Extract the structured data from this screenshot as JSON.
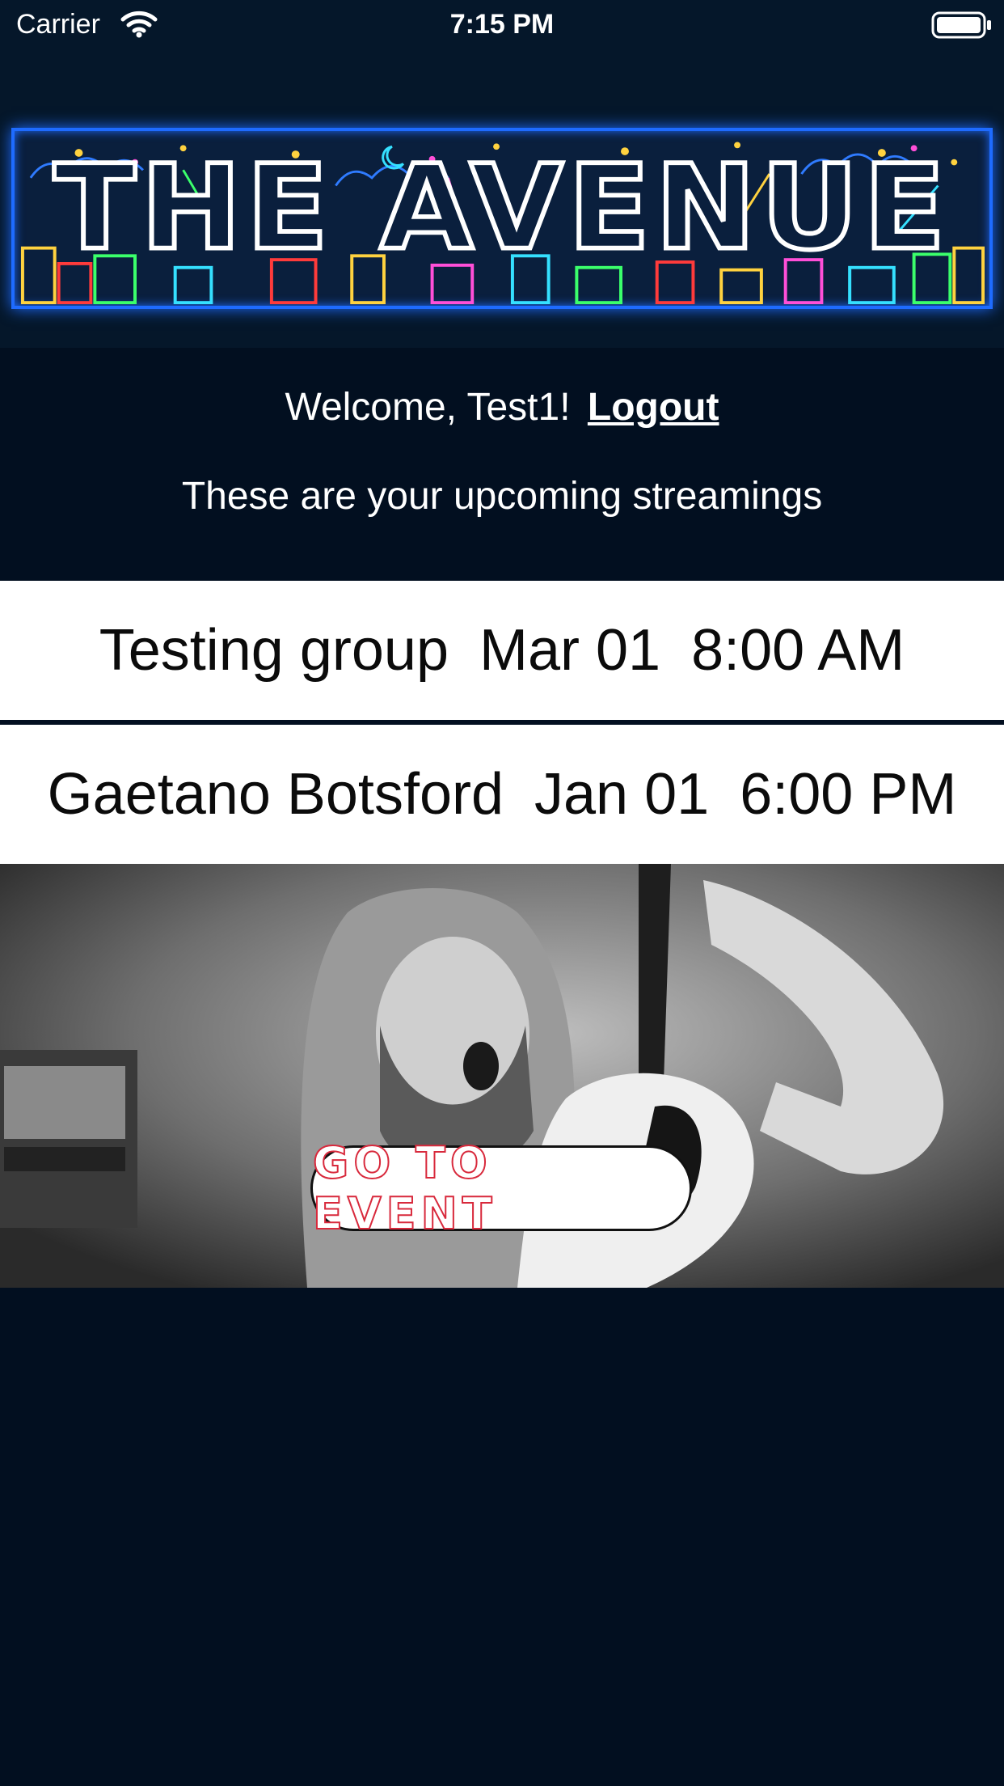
{
  "status_bar": {
    "carrier": "Carrier",
    "time": "7:15 PM",
    "icons": [
      "wifi-icon",
      "battery-icon"
    ]
  },
  "logo": {
    "text": "THE AVENUE",
    "frame_color": "#1e6bff"
  },
  "welcome": {
    "greeting": "Welcome, Test1!",
    "logout_label": "Logout"
  },
  "subtitle": "These are your upcoming streamings",
  "streams": [
    {
      "name": "Testing group",
      "date": "Mar 01",
      "time": "8:00 AM"
    },
    {
      "name": "Gaetano Botsford",
      "date": "Jan 01",
      "time": "6:00 PM"
    }
  ],
  "event": {
    "button_label": "GO TO EVENT",
    "button_text_color": "#d8293c"
  },
  "colors": {
    "background": "#020f20",
    "header": "#05172a",
    "row_background": "#ffffff"
  }
}
